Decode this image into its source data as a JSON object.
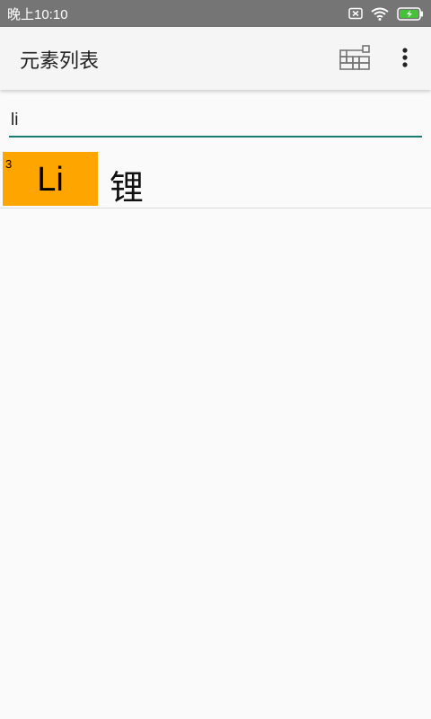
{
  "status_bar": {
    "time": "晚上10:10",
    "icons": [
      "sim-off-icon",
      "wifi-icon",
      "battery-charging-icon"
    ],
    "battery_color": "#46c23a"
  },
  "app_bar": {
    "title": "元素列表",
    "actions": [
      "periodic-table-icon",
      "more-vert-icon"
    ]
  },
  "search": {
    "value": "li",
    "accent_color": "#167a77"
  },
  "results": [
    {
      "atomic_number": "3",
      "symbol": "Li",
      "name": "锂",
      "tile_color": "#ffa500"
    }
  ]
}
